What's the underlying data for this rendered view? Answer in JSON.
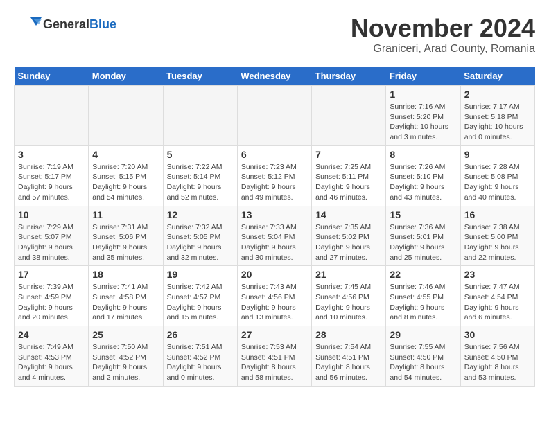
{
  "header": {
    "logo_general": "General",
    "logo_blue": "Blue",
    "month_title": "November 2024",
    "location": "Graniceri, Arad County, Romania"
  },
  "weekdays": [
    "Sunday",
    "Monday",
    "Tuesday",
    "Wednesday",
    "Thursday",
    "Friday",
    "Saturday"
  ],
  "weeks": [
    [
      {
        "day": "",
        "info": ""
      },
      {
        "day": "",
        "info": ""
      },
      {
        "day": "",
        "info": ""
      },
      {
        "day": "",
        "info": ""
      },
      {
        "day": "",
        "info": ""
      },
      {
        "day": "1",
        "info": "Sunrise: 7:16 AM\nSunset: 5:20 PM\nDaylight: 10 hours\nand 3 minutes."
      },
      {
        "day": "2",
        "info": "Sunrise: 7:17 AM\nSunset: 5:18 PM\nDaylight: 10 hours\nand 0 minutes."
      }
    ],
    [
      {
        "day": "3",
        "info": "Sunrise: 7:19 AM\nSunset: 5:17 PM\nDaylight: 9 hours\nand 57 minutes."
      },
      {
        "day": "4",
        "info": "Sunrise: 7:20 AM\nSunset: 5:15 PM\nDaylight: 9 hours\nand 54 minutes."
      },
      {
        "day": "5",
        "info": "Sunrise: 7:22 AM\nSunset: 5:14 PM\nDaylight: 9 hours\nand 52 minutes."
      },
      {
        "day": "6",
        "info": "Sunrise: 7:23 AM\nSunset: 5:12 PM\nDaylight: 9 hours\nand 49 minutes."
      },
      {
        "day": "7",
        "info": "Sunrise: 7:25 AM\nSunset: 5:11 PM\nDaylight: 9 hours\nand 46 minutes."
      },
      {
        "day": "8",
        "info": "Sunrise: 7:26 AM\nSunset: 5:10 PM\nDaylight: 9 hours\nand 43 minutes."
      },
      {
        "day": "9",
        "info": "Sunrise: 7:28 AM\nSunset: 5:08 PM\nDaylight: 9 hours\nand 40 minutes."
      }
    ],
    [
      {
        "day": "10",
        "info": "Sunrise: 7:29 AM\nSunset: 5:07 PM\nDaylight: 9 hours\nand 38 minutes."
      },
      {
        "day": "11",
        "info": "Sunrise: 7:31 AM\nSunset: 5:06 PM\nDaylight: 9 hours\nand 35 minutes."
      },
      {
        "day": "12",
        "info": "Sunrise: 7:32 AM\nSunset: 5:05 PM\nDaylight: 9 hours\nand 32 minutes."
      },
      {
        "day": "13",
        "info": "Sunrise: 7:33 AM\nSunset: 5:04 PM\nDaylight: 9 hours\nand 30 minutes."
      },
      {
        "day": "14",
        "info": "Sunrise: 7:35 AM\nSunset: 5:02 PM\nDaylight: 9 hours\nand 27 minutes."
      },
      {
        "day": "15",
        "info": "Sunrise: 7:36 AM\nSunset: 5:01 PM\nDaylight: 9 hours\nand 25 minutes."
      },
      {
        "day": "16",
        "info": "Sunrise: 7:38 AM\nSunset: 5:00 PM\nDaylight: 9 hours\nand 22 minutes."
      }
    ],
    [
      {
        "day": "17",
        "info": "Sunrise: 7:39 AM\nSunset: 4:59 PM\nDaylight: 9 hours\nand 20 minutes."
      },
      {
        "day": "18",
        "info": "Sunrise: 7:41 AM\nSunset: 4:58 PM\nDaylight: 9 hours\nand 17 minutes."
      },
      {
        "day": "19",
        "info": "Sunrise: 7:42 AM\nSunset: 4:57 PM\nDaylight: 9 hours\nand 15 minutes."
      },
      {
        "day": "20",
        "info": "Sunrise: 7:43 AM\nSunset: 4:56 PM\nDaylight: 9 hours\nand 13 minutes."
      },
      {
        "day": "21",
        "info": "Sunrise: 7:45 AM\nSunset: 4:56 PM\nDaylight: 9 hours\nand 10 minutes."
      },
      {
        "day": "22",
        "info": "Sunrise: 7:46 AM\nSunset: 4:55 PM\nDaylight: 9 hours\nand 8 minutes."
      },
      {
        "day": "23",
        "info": "Sunrise: 7:47 AM\nSunset: 4:54 PM\nDaylight: 9 hours\nand 6 minutes."
      }
    ],
    [
      {
        "day": "24",
        "info": "Sunrise: 7:49 AM\nSunset: 4:53 PM\nDaylight: 9 hours\nand 4 minutes."
      },
      {
        "day": "25",
        "info": "Sunrise: 7:50 AM\nSunset: 4:52 PM\nDaylight: 9 hours\nand 2 minutes."
      },
      {
        "day": "26",
        "info": "Sunrise: 7:51 AM\nSunset: 4:52 PM\nDaylight: 9 hours\nand 0 minutes."
      },
      {
        "day": "27",
        "info": "Sunrise: 7:53 AM\nSunset: 4:51 PM\nDaylight: 8 hours\nand 58 minutes."
      },
      {
        "day": "28",
        "info": "Sunrise: 7:54 AM\nSunset: 4:51 PM\nDaylight: 8 hours\nand 56 minutes."
      },
      {
        "day": "29",
        "info": "Sunrise: 7:55 AM\nSunset: 4:50 PM\nDaylight: 8 hours\nand 54 minutes."
      },
      {
        "day": "30",
        "info": "Sunrise: 7:56 AM\nSunset: 4:50 PM\nDaylight: 8 hours\nand 53 minutes."
      }
    ]
  ]
}
